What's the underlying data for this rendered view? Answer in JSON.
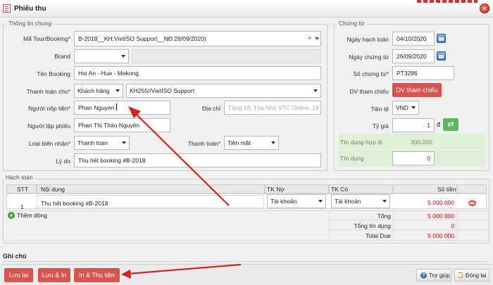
{
  "window": {
    "title": "Phiếu thu",
    "close_glyph": "×"
  },
  "general": {
    "legend": "Thông tin chung",
    "tour_label": "Mã Tour/Booking",
    "tour_value": "B-2018__KH:VietISO Support__NĐ:28/09/2020)",
    "tour_clear": "×",
    "brand_label": "Brand",
    "brand_value": "",
    "booking_name_label": "Tên Booking",
    "booking_name_value": "Hoi An - Hue - Mekong",
    "pay_for_label": "Thanh toán cho",
    "pay_for_value": "Khách hàng",
    "customer_value": "KH255//VietISO Support",
    "payer_label": "Người nộp tiền",
    "payer_value": "Phan Nguyen",
    "address_label": "Địa chỉ",
    "address_placeholder": "Tầng 18, Tòa Nhà VTC Online, 18 Tam",
    "creator_label": "Người lập phiếu",
    "creator_value": "Phan Thị  Thảo Nguyên",
    "receipt_type_label": "Loại biên nhận",
    "receipt_type_value": "Thanh toán",
    "payment_label": "Thanh toán",
    "payment_value": "Tiền mặt",
    "reason_label": "Lý do",
    "reason_value": "Thu hết booking #B-2018"
  },
  "voucher": {
    "legend": "Chứng từ",
    "posting_date_label": "Ngày hạch toán",
    "posting_date_value": "04/10/2020",
    "voucher_date_label": "Ngày chứng từ",
    "voucher_date_value": "26/09/2020",
    "voucher_no_label": "Số chứng từ",
    "voucher_no_value": "PT3286",
    "reference_label": "DV tham chiếu",
    "reference_button": "DV tham chiếu",
    "currency_label": "Tiền tệ",
    "currency_value": "VND",
    "rate_label": "Tỷ giá",
    "rate_value": "1",
    "rate_unit": "đ",
    "swap_glyph": "⇄",
    "valid_credit_label": "Tín dụng hợp lệ",
    "valid_credit_value": "300.000",
    "credit_label": "Tín dụng",
    "credit_value": "0"
  },
  "accounting": {
    "legend": "Hạch toán",
    "headers": {
      "stt": "STT",
      "content": "Nội dung",
      "debit": "TK Nợ",
      "credit": "TK Có",
      "amount": "Số tiền"
    },
    "row": {
      "stt": "1",
      "content": "Thu hết booking #B-2018",
      "debit": "Tài khoản",
      "credit": "Tài khoản",
      "amount": "5 000 000"
    },
    "add_row": "Thêm dòng",
    "plus_glyph": "+",
    "total_label": "Tổng",
    "total_value": "5 000 000",
    "total_credit_label": "Tổng tín dụng",
    "total_credit_value": "0",
    "total_due_label": "Total Due",
    "total_due_value": "5 000 000"
  },
  "notes": {
    "label": "Ghi chú"
  },
  "footer": {
    "save": "Lưu lại",
    "save_print": "Lưu & In",
    "print_receive": "In & Thu tiền",
    "help": "Trợ giúp",
    "help_glyph": "?",
    "close": "Đóng lại"
  },
  "colors": {
    "accent_red": "#d9534f",
    "green_bg": "#dff0d8",
    "arrow": "#d42222"
  }
}
